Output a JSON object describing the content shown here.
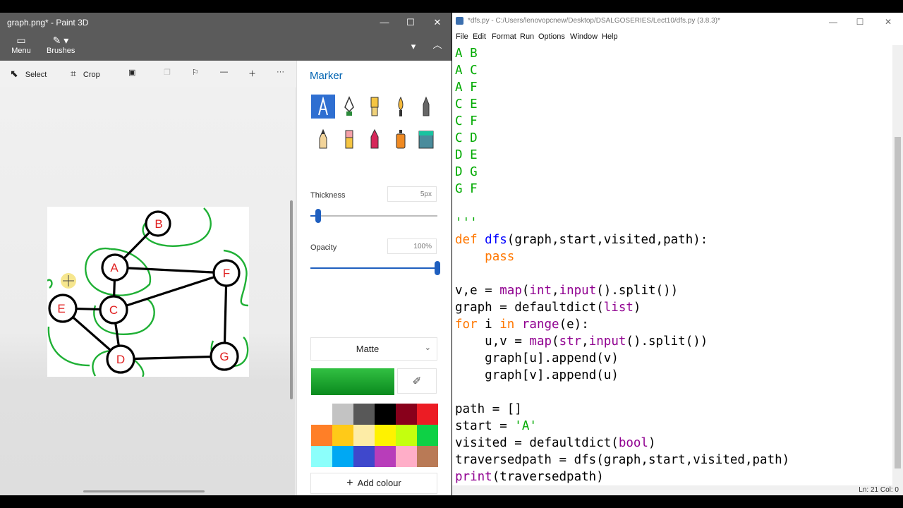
{
  "paint": {
    "title": "graph.png* - Paint 3D",
    "ribbon": {
      "menu": "Menu",
      "brushes": "Brushes"
    },
    "toolbar": {
      "select": "Select",
      "crop": "Crop"
    },
    "panel": {
      "title": "Marker",
      "thickness_label": "Thickness",
      "thickness_value": "5px",
      "thickness_fraction": 0.06,
      "opacity_label": "Opacity",
      "opacity_value": "100%",
      "opacity_fraction": 1.0,
      "finish": "Matte",
      "selected_color": "#1fb035",
      "add_colour": "Add colour",
      "palette": [
        "#ffffff",
        "#c3c3c3",
        "#585858",
        "#000000",
        "#88001b",
        "#ec1c24",
        "#ff7f27",
        "#ffca18",
        "#fdeca6",
        "#fff200",
        "#c4ff0e",
        "#0ed145",
        "#8cfffb",
        "#00a8f3",
        "#3f48cc",
        "#b83dba",
        "#ffaec8",
        "#b97a56"
      ]
    },
    "graph": {
      "nodes": [
        "A",
        "B",
        "C",
        "D",
        "E",
        "F",
        "G"
      ],
      "edges": [
        [
          "A",
          "B"
        ],
        [
          "A",
          "C"
        ],
        [
          "A",
          "F"
        ],
        [
          "C",
          "E"
        ],
        [
          "C",
          "F"
        ],
        [
          "C",
          "D"
        ],
        [
          "D",
          "E"
        ],
        [
          "D",
          "G"
        ],
        [
          "G",
          "F"
        ]
      ]
    }
  },
  "idle": {
    "title": "*dfs.py - C:/Users/lenovopcnew/Desktop/DSALGOSERIES/Lect10/dfs.py (3.8.3)*",
    "menu": [
      "File",
      "Edit",
      "Format",
      "Run",
      "Options",
      "Window",
      "Help"
    ],
    "code_lines": [
      "A B",
      "A C",
      "A F",
      "C E",
      "C F",
      "C D",
      "D E",
      "D G",
      "G F",
      "",
      "'''",
      "def dfs(graph,start,visited,path):",
      "    pass",
      "",
      "v,e = map(int,input().split())",
      "graph = defaultdict(list)",
      "for i in range(e):",
      "    u,v = map(str,input().split())",
      "    graph[u].append(v)",
      "    graph[v].append(u)",
      "",
      "path = []",
      "start = 'A'",
      "visited = defaultdict(bool)",
      "traversedpath = dfs(graph,start,visited,path)",
      "print(traversedpath)"
    ],
    "status": "Ln: 21  Col: 0"
  }
}
